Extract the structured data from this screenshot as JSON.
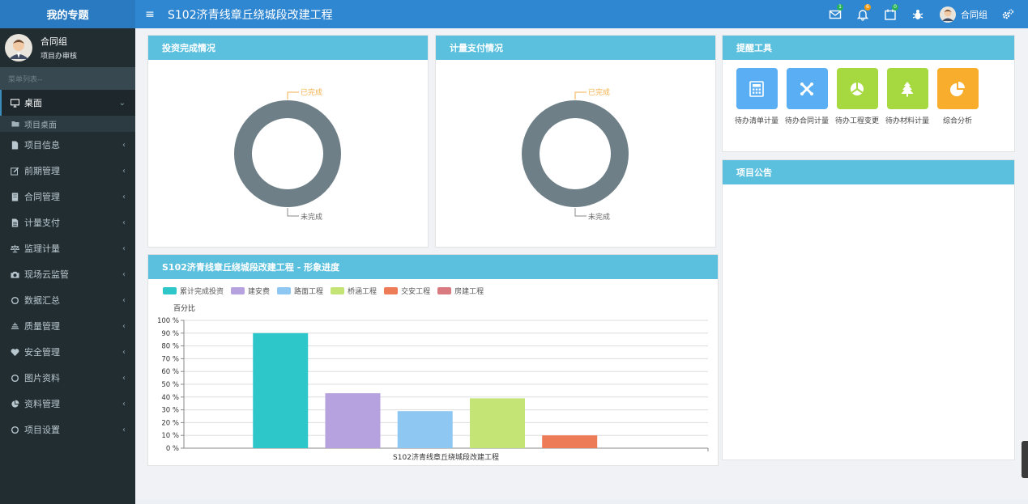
{
  "header": {
    "brand": "我的专题",
    "title": "S102济青线章丘绕城段改建工程",
    "mail_badge": "1",
    "bell_badge": "6",
    "calendar_badge": "0",
    "user_name": "合同组"
  },
  "sidebar": {
    "user_name": "合同组",
    "user_role": "项目办审核",
    "search_placeholder": "菜单列表--",
    "items": [
      {
        "label": "桌面",
        "icon": "monitor-icon"
      },
      {
        "label": "项目信息",
        "icon": "file-icon"
      },
      {
        "label": "前期管理",
        "icon": "edit-icon"
      },
      {
        "label": "合同管理",
        "icon": "building-icon"
      },
      {
        "label": "计量支付",
        "icon": "file-text-icon"
      },
      {
        "label": "监理计量",
        "icon": "balance-icon"
      },
      {
        "label": "现场云监管",
        "icon": "camera-icon"
      },
      {
        "label": "数据汇总",
        "icon": "circle-icon"
      },
      {
        "label": "质量管理",
        "icon": "quality-icon"
      },
      {
        "label": "安全管理",
        "icon": "heart-icon"
      },
      {
        "label": "图片资料",
        "icon": "circle-icon"
      },
      {
        "label": "资料管理",
        "icon": "pie-icon"
      },
      {
        "label": "项目设置",
        "icon": "circle-icon"
      }
    ],
    "sub_item": "项目桌面"
  },
  "panels": {
    "investment": {
      "title": "投资完成情况",
      "label_done": "已完成",
      "label_undone": "未完成",
      "done_pct": 0
    },
    "payment": {
      "title": "计量支付情况",
      "label_done": "已完成",
      "label_undone": "未完成",
      "done_pct": 0
    },
    "reminder": {
      "title": "提醒工具",
      "tools": [
        {
          "label": "待办清单计量",
          "icon": "calculator-icon",
          "color": "#5aaef4"
        },
        {
          "label": "待办合同计量",
          "icon": "joomla-icon",
          "color": "#5aaef4"
        },
        {
          "label": "待办工程变更",
          "icon": "pie-cut-icon",
          "color": "#a6d93f"
        },
        {
          "label": "待办材料计量",
          "icon": "tree-icon",
          "color": "#a6d93f"
        },
        {
          "label": "综合分析",
          "icon": "pie-chart-icon",
          "color": "#f9ad2d"
        }
      ]
    },
    "notice": {
      "title": "项目公告"
    },
    "progress": {
      "title": "S102济青线章丘绕城段改建工程 - 形象进度"
    }
  },
  "chart_data": {
    "type": "bar",
    "ylabel": "百分比",
    "xlabel": "S102济青线章丘绕城段改建工程",
    "ylim": [
      0,
      100
    ],
    "yticks": [
      "0 %",
      "10 %",
      "20 %",
      "30 %",
      "40 %",
      "50 %",
      "60 %",
      "70 %",
      "80 %",
      "90 %",
      "100 %"
    ],
    "series": [
      {
        "name": "累计完成投资",
        "value": 90,
        "color": "#2ec7c9"
      },
      {
        "name": "建安费",
        "value": 43,
        "color": "#b6a2de"
      },
      {
        "name": "路面工程",
        "value": 29,
        "color": "#8ec7f2"
      },
      {
        "name": "桥涵工程",
        "value": 39,
        "color": "#c4e476"
      },
      {
        "name": "交安工程",
        "value": 10,
        "color": "#ee7b57"
      },
      {
        "name": "房建工程",
        "value": 0,
        "color": "#d87a80"
      }
    ]
  }
}
